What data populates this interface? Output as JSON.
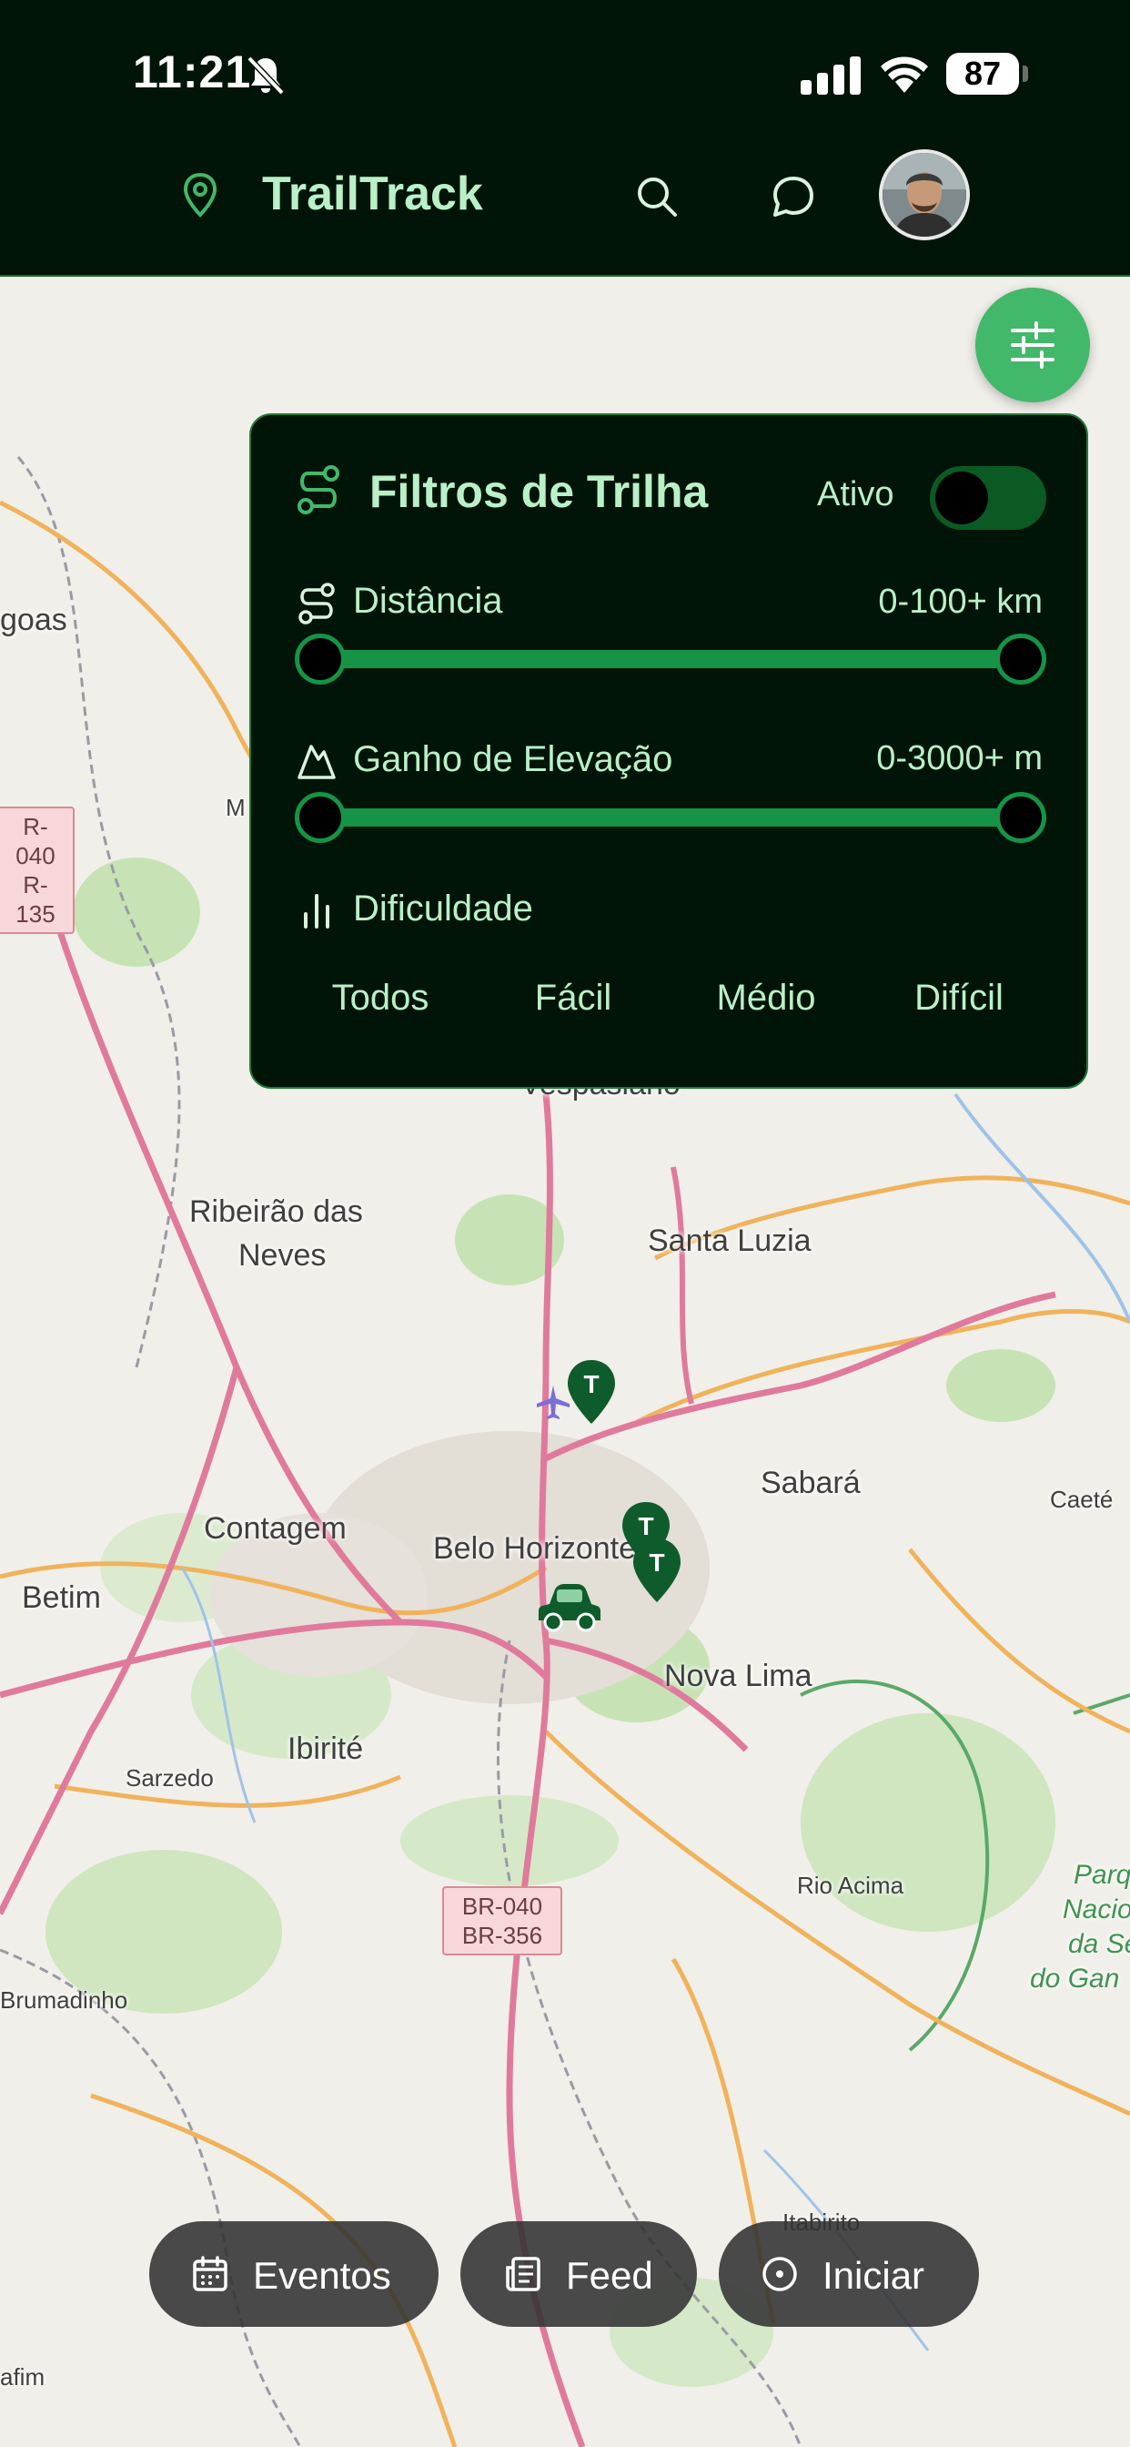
{
  "status_bar": {
    "time": "11:21",
    "battery": "87"
  },
  "header": {
    "app_title": "TrailTrack",
    "colors": {
      "background": "#001407",
      "accent": "#b9f0c8"
    }
  },
  "filter_panel": {
    "title": "Filtros de Trilha",
    "active_label": "Ativo",
    "active_on": false,
    "distance": {
      "label": "Distância",
      "value": "0-100+ km",
      "range": [
        0,
        100
      ]
    },
    "elevation": {
      "label": "Ganho de Elevação",
      "value": "0-3000+ m",
      "range": [
        0,
        3000
      ]
    },
    "difficulty": {
      "label": "Dificuldade",
      "options": [
        "Todos",
        "Fácil",
        "Médio",
        "Difícil"
      ]
    }
  },
  "map": {
    "places": {
      "goas": "goas",
      "vespasiano": "Vespasiano",
      "ribeirao": "Ribeirão das",
      "neves": "Neves",
      "santa_luzia": "Santa Luzia",
      "sabara": "Sabará",
      "caete": "Caeté",
      "contagem": "Contagem",
      "belo_horizonte": "Belo Horizonte",
      "betim": "Betim",
      "nova_lima": "Nova Lima",
      "ibirite": "Ibirité",
      "sarzedo": "Sarzedo",
      "rio_acima": "Rio Acima",
      "brumadinho": "Brumadinho",
      "itabirito": "Itabirito",
      "afim": "afim",
      "m": "M",
      "park_1": "Parq",
      "park_2": "Nacio",
      "park_3": "da Se",
      "park_4": "do Gan"
    },
    "road_shields": {
      "left_1": "R-040",
      "left_2": "R-135",
      "center_1": "BR-040",
      "center_2": "BR-356"
    },
    "trail_marker_letter": "T"
  },
  "bottom_nav": {
    "events_label": "Eventos",
    "feed_label": "Feed",
    "start_label": "Iniciar"
  }
}
